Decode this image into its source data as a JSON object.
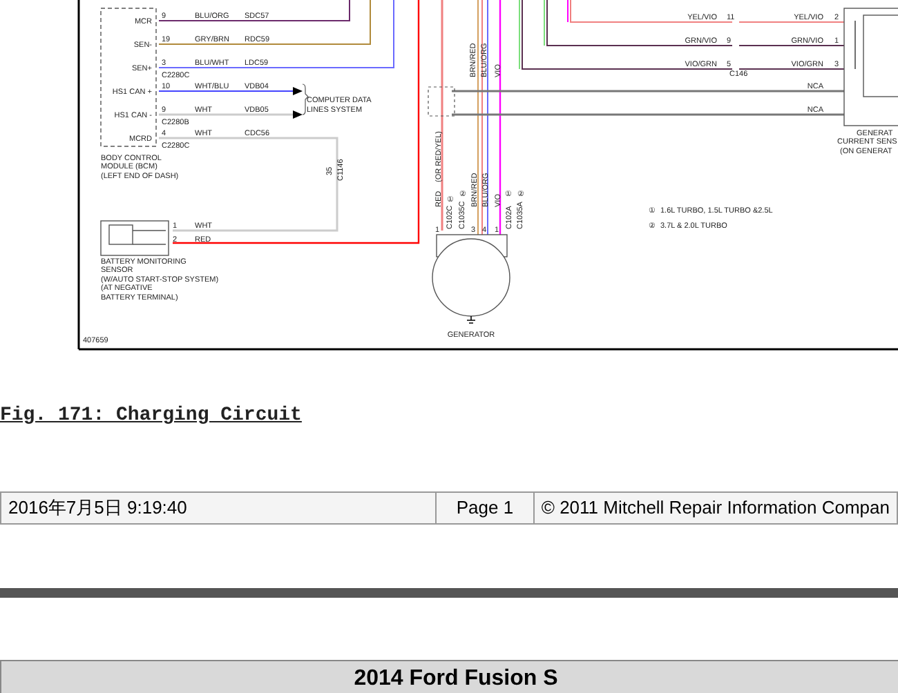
{
  "diagram": {
    "labels": [
      "MCR",
      "SEN-",
      "SEN+",
      "HS1 CAN +",
      "HS1 CAN -",
      "MCRD",
      "9",
      "19",
      "3",
      "10",
      "9",
      "4",
      "BLU/ORG",
      "GRY/BRN",
      "BLU/WHT",
      "WHT/BLU",
      "WHT",
      "WHT",
      "SDC57",
      "RDC59",
      "LDC59",
      "VDB04",
      "VDB05",
      "CDC56",
      "C2280C",
      "C2280B",
      "C2280C",
      "COMPUTER DATA",
      "LINES SYSTEM",
      "BODY CONTROL",
      "MODULE (BCM)",
      "(LEFT END OF DASH)",
      "35",
      "C1146",
      "1",
      "2",
      "WHT",
      "RED",
      "BATTERY MONITORING",
      "SENSOR",
      "(W/AUTO START-STOP SYSTEM)",
      "(AT NEGATIVE",
      "BATTERY TERMINAL)",
      "407659",
      "(OR RED/YEL)",
      "BRN/RED",
      "BLU/ORG",
      "VIO",
      "RED",
      "C102C",
      "①",
      "C1035C",
      "②",
      "BRN/RED",
      "BLU/ORG",
      "VIO",
      "C102A",
      "①",
      "C1035A",
      "②",
      "1",
      "3",
      "4",
      "1",
      "GENERATOR",
      "YEL/VIO",
      "11",
      "GRN/VIO",
      "9",
      "VIO/GRN",
      "5",
      "C146",
      "YEL/VIO",
      "2",
      "GRN/VIO",
      "1",
      "VIO/GRN",
      "3",
      "NCA",
      "NCA",
      "GENERAT",
      "CURRENT SENS",
      "(ON GENERAT",
      "①",
      "1.6L TURBO, 1.5L TURBO &2.5L",
      "②",
      "3.7L & 2.0L TURBO"
    ]
  },
  "caption": "Fig. 171: Charging Circuit",
  "footer": {
    "cells": [
      "2016年7月5日  9:19:40",
      "Page 1",
      "© 2011 Mitchell Repair Information Compan"
    ]
  },
  "vehicle_title": "2014 Ford Fusion S"
}
